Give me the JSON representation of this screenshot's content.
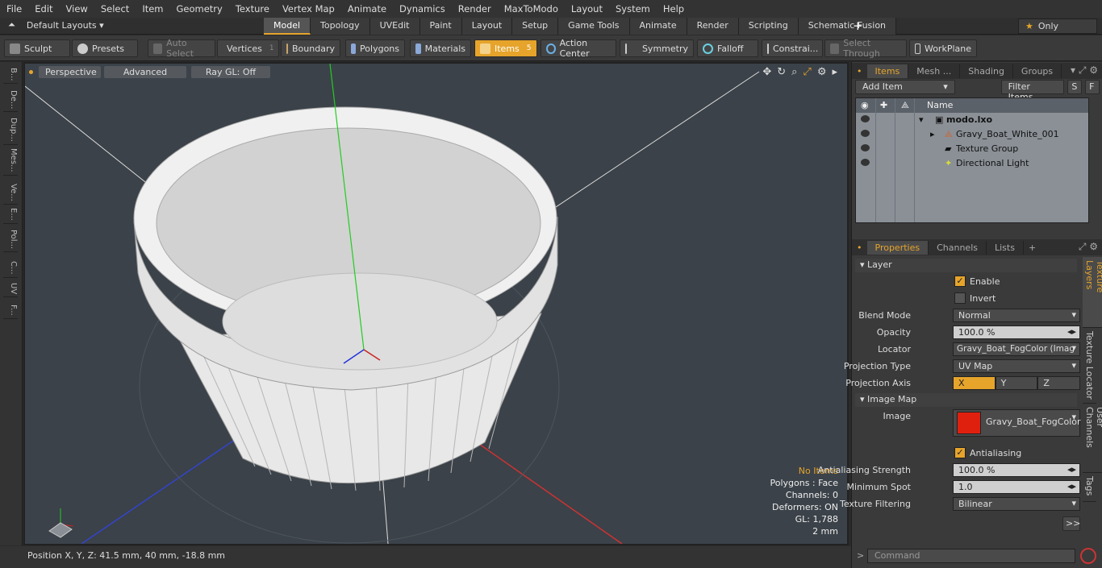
{
  "menu": [
    "File",
    "Edit",
    "View",
    "Select",
    "Item",
    "Geometry",
    "Texture",
    "Vertex Map",
    "Animate",
    "Dynamics",
    "Render",
    "MaxToModo",
    "Layout",
    "System",
    "Help"
  ],
  "layouts": {
    "label": "Default Layouts ▾"
  },
  "mode_tabs": [
    "Model",
    "Topology",
    "UVEdit",
    "Paint",
    "Layout",
    "Setup",
    "Game Tools",
    "Animate",
    "Render",
    "Scripting",
    "Schematic Fusion"
  ],
  "only_label": "Only",
  "toolbar": {
    "sculpt": "Sculpt",
    "presets": "Presets",
    "auto_select": "Auto Select",
    "vertices": "Vertices",
    "vertices_count": "1",
    "boundary": "Boundary",
    "polygons": "Polygons",
    "materials": "Materials",
    "items": "Items",
    "items_count": "5",
    "action_center": "Action Center",
    "symmetry": "Symmetry",
    "falloff": "Falloff",
    "constraints": "Constrai...",
    "select_through": "Select Through",
    "workplane": "WorkPlane"
  },
  "left_tabs": [
    "B...",
    "De...",
    "Dup...",
    "Mes...",
    "Ve...",
    "E...",
    "Pol...",
    "C...",
    "UV",
    "F..."
  ],
  "viewport": {
    "view": "Perspective",
    "shading": "Advanced",
    "raygl": "Ray GL: Off",
    "info": {
      "warn": "No Items",
      "polygons": "Polygons : Face",
      "channels": "Channels: 0",
      "deformers": "Deformers: ON",
      "gl": "GL: 1,788",
      "scale": "2 mm"
    }
  },
  "status": "Position X, Y, Z:   41.5 mm, 40 mm, -18.8 mm",
  "items_panel": {
    "tabs": [
      "Items",
      "Mesh ...",
      "Shading",
      "Groups"
    ],
    "add_item": "Add Item",
    "filter": "Filter Items",
    "s": "S",
    "f": "F",
    "name_header": "Name",
    "rows": [
      {
        "label": "modo.lxo"
      },
      {
        "label": "Gravy_Boat_White_001"
      },
      {
        "label": "Texture Group"
      },
      {
        "label": "Directional Light"
      }
    ]
  },
  "props_panel": {
    "tabs": [
      "Properties",
      "Channels",
      "Lists"
    ],
    "layer_section": "Layer",
    "enable": "Enable",
    "invert": "Invert",
    "blend_mode_label": "Blend Mode",
    "blend_mode": "Normal",
    "opacity_label": "Opacity",
    "opacity": "100.0 %",
    "locator_label": "Locator",
    "locator": "Gravy_Boat_FogColor (Imag ...",
    "proj_type_label": "Projection Type",
    "proj_type": "UV Map",
    "proj_axis_label": "Projection Axis",
    "axis_x": "X",
    "axis_y": "Y",
    "axis_z": "Z",
    "image_map_section": "Image Map",
    "image_label": "Image",
    "image": "Gravy_Boat_FogColor",
    "image_swatch": "#e0200f",
    "antialiasing": "Antialiasing",
    "aa_strength_label": "Antialiasing Strength",
    "aa_strength": "100.0 %",
    "min_spot_label": "Minimum Spot",
    "min_spot": "1.0",
    "tex_filter_label": "Texture Filtering",
    "tex_filter": "Bilinear",
    "more": ">>",
    "side_tabs": [
      "Texture Layers",
      "Texture Locator",
      "User Channels",
      "Tags"
    ],
    "command": "Command"
  }
}
